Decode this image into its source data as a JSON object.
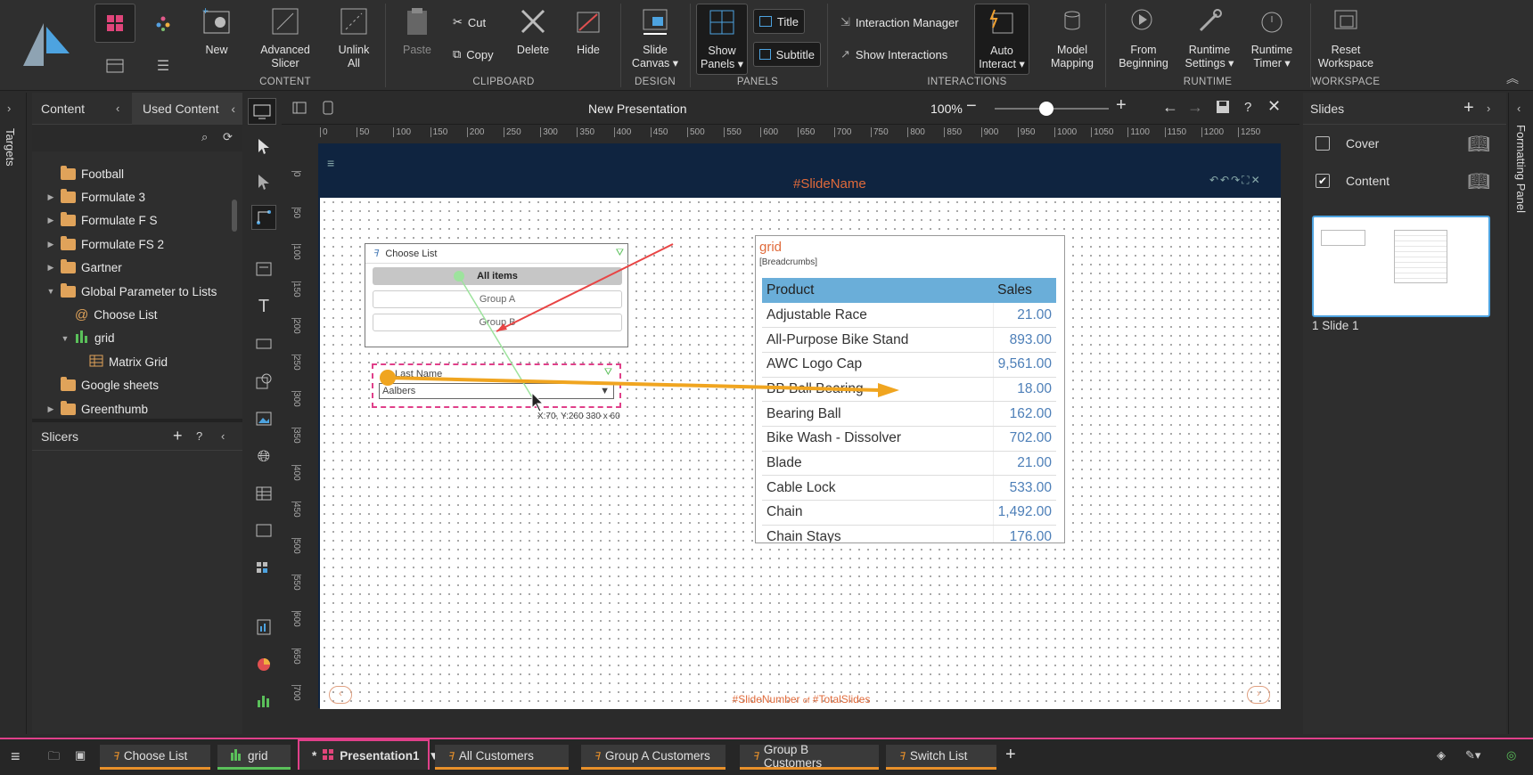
{
  "ribbon": {
    "new": "New",
    "advanced_slicer": "Advanced\nSlicer",
    "unlink_all": "Unlink\nAll",
    "group_content": "CONTENT",
    "paste": "Paste",
    "cut": "Cut",
    "copy": "Copy",
    "delete": "Delete",
    "hide": "Hide",
    "group_clipboard": "CLIPBOARD",
    "slide_canvas": "Slide\nCanvas ▾",
    "group_design": "DESIGN",
    "show_panels": "Show\nPanels ▾",
    "title": "Title",
    "subtitle": "Subtitle",
    "group_panels": "PANELS",
    "interaction_manager": "Interaction Manager",
    "show_interactions": "Show Interactions",
    "auto_interact": "Auto\nInteract ▾",
    "model_mapping": "Model\nMapping",
    "group_interactions": "INTERACTIONS",
    "from_beginning": "From\nBeginning",
    "runtime_settings": "Runtime\nSettings ▾",
    "runtime_timer": "Runtime\nTimer ▾",
    "group_runtime": "RUNTIME",
    "reset_workspace": "Reset\nWorkspace",
    "group_workspace": "WORKSPACE"
  },
  "left": {
    "targets": "Targets",
    "content_tab": "Content",
    "used_content_tab": "Used Content",
    "tree": [
      {
        "label": "Football",
        "type": "folder",
        "indent": 0,
        "arrow": ""
      },
      {
        "label": "Formulate 3",
        "type": "folder",
        "indent": 0,
        "arrow": "▶"
      },
      {
        "label": "Formulate F S",
        "type": "folder",
        "indent": 0,
        "arrow": "▶"
      },
      {
        "label": "Formulate FS 2",
        "type": "folder",
        "indent": 0,
        "arrow": "▶"
      },
      {
        "label": "Gartner",
        "type": "folder",
        "indent": 0,
        "arrow": "▶"
      },
      {
        "label": "Global Parameter to Lists",
        "type": "folder",
        "indent": 0,
        "arrow": "▼"
      },
      {
        "label": "Choose List",
        "type": "param",
        "indent": 1,
        "arrow": ""
      },
      {
        "label": "grid",
        "type": "chart",
        "indent": 1,
        "arrow": "▼"
      },
      {
        "label": "Matrix Grid",
        "type": "grid",
        "indent": 2,
        "arrow": ""
      },
      {
        "label": "Google sheets",
        "type": "folder",
        "indent": 0,
        "arrow": ""
      },
      {
        "label": "Greenthumb",
        "type": "folder",
        "indent": 0,
        "arrow": "▶"
      }
    ],
    "slicers": "Slicers"
  },
  "topbar": {
    "title": "New Presentation",
    "zoom": "100%",
    "zoom_level": 0.45
  },
  "ruler": {
    "h": [
      "0",
      "50",
      "100",
      "150",
      "200",
      "250",
      "300",
      "350",
      "400",
      "450",
      "500",
      "550",
      "600",
      "650",
      "700",
      "750",
      "800",
      "850",
      "900",
      "950",
      "1000",
      "1050",
      "1100",
      "1150",
      "1200",
      "1250"
    ],
    "v": [
      "0",
      "50",
      "100",
      "150",
      "200",
      "250",
      "300",
      "350",
      "400",
      "450",
      "500",
      "550",
      "600",
      "650",
      "700"
    ]
  },
  "slide": {
    "slide_name": "#SlideName",
    "slide_number": "#SlideNumber",
    "of": "of",
    "total": "#TotalSlides",
    "choose_list": {
      "title": "Choose List",
      "items": [
        "All items",
        "Group A",
        "Group B"
      ]
    },
    "last_name": {
      "title": "Last Name",
      "value": "Aalbers"
    },
    "coord": "X:70, Y:260 330 x 60",
    "grid": {
      "title": "grid",
      "breadcrumbs": "[Breadcrumbs]",
      "headers": [
        "Product",
        "Sales"
      ],
      "rows": [
        [
          "Adjustable Race",
          "21.00"
        ],
        [
          "All-Purpose Bike Stand",
          "893.00"
        ],
        [
          "AWC Logo Cap",
          "9,561.00"
        ],
        [
          "BB Ball Bearing",
          "18.00"
        ],
        [
          "Bearing Ball",
          "162.00"
        ],
        [
          "Bike Wash - Dissolver",
          "702.00"
        ],
        [
          "Blade",
          "21.00"
        ],
        [
          "Cable Lock",
          "533.00"
        ],
        [
          "Chain",
          "1,492.00"
        ],
        [
          "Chain Stays",
          "176.00"
        ]
      ]
    }
  },
  "slides_panel": {
    "title": "Slides",
    "items": [
      {
        "label": "Cover",
        "checked": false
      },
      {
        "label": "Content",
        "checked": true
      }
    ],
    "thumb_label": "1 Slide 1",
    "formatting": "Formatting Panel"
  },
  "bottom": {
    "tabs": [
      {
        "label": "Choose List",
        "kind": "formula"
      },
      {
        "label": "grid",
        "kind": "chart"
      },
      {
        "label": "Presentation1",
        "kind": "pres",
        "prefix": "*"
      },
      {
        "label": "All Customers",
        "kind": "formula"
      },
      {
        "label": "Group A Customers",
        "kind": "formula"
      },
      {
        "label": "Group B Customers",
        "kind": "formula"
      },
      {
        "label": "Switch List",
        "kind": "formula"
      }
    ]
  }
}
